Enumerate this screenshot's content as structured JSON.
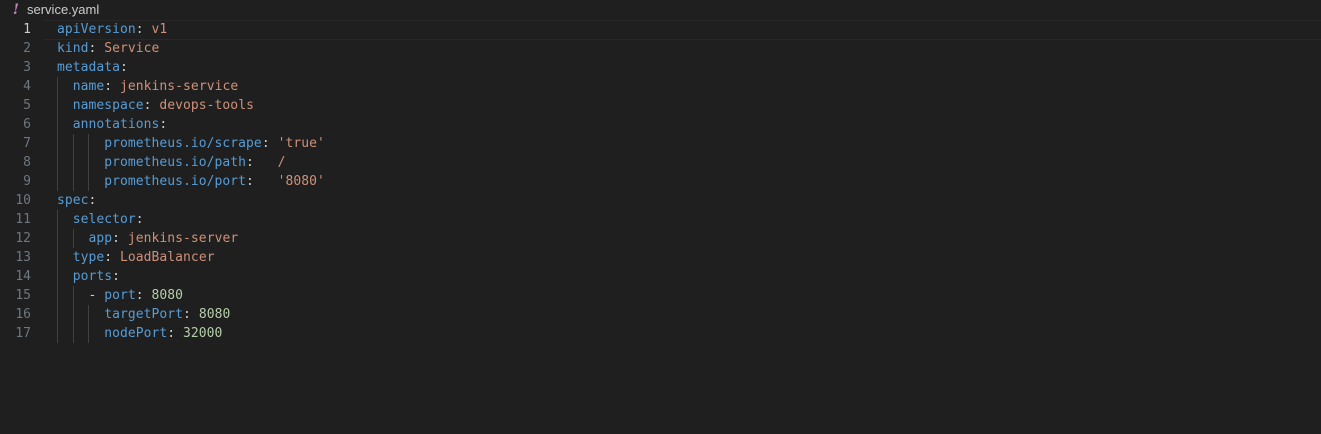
{
  "tab": {
    "icon": "yaml-exclamation-icon",
    "filename": "service.yaml"
  },
  "editor": {
    "current_line": 1,
    "lines": [
      {
        "num": "1",
        "indent": "",
        "key": "apiVersion",
        "sep": ": ",
        "value": "v1",
        "vtype": "s"
      },
      {
        "num": "2",
        "indent": "",
        "key": "kind",
        "sep": ": ",
        "value": "Service",
        "vtype": "s"
      },
      {
        "num": "3",
        "indent": "",
        "key": "metadata",
        "sep": ":",
        "value": "",
        "vtype": "s"
      },
      {
        "num": "4",
        "indent": "  ",
        "key": "name",
        "sep": ": ",
        "value": "jenkins-service",
        "vtype": "s"
      },
      {
        "num": "5",
        "indent": "  ",
        "key": "namespace",
        "sep": ": ",
        "value": "devops-tools",
        "vtype": "s"
      },
      {
        "num": "6",
        "indent": "  ",
        "key": "annotations",
        "sep": ":",
        "value": "",
        "vtype": "s"
      },
      {
        "num": "7",
        "indent": "      ",
        "key": "prometheus.io/scrape",
        "sep": ": ",
        "value": "'true'",
        "vtype": "s"
      },
      {
        "num": "8",
        "indent": "      ",
        "key": "prometheus.io/path",
        "sep": ":   ",
        "value": "/",
        "vtype": "s"
      },
      {
        "num": "9",
        "indent": "      ",
        "key": "prometheus.io/port",
        "sep": ":   ",
        "value": "'8080'",
        "vtype": "s"
      },
      {
        "num": "10",
        "indent": "",
        "key": "spec",
        "sep": ":",
        "value": "",
        "vtype": "s"
      },
      {
        "num": "11",
        "indent": "  ",
        "key": "selector",
        "sep": ":",
        "value": "",
        "vtype": "s"
      },
      {
        "num": "12",
        "indent": "    ",
        "key": "app",
        "sep": ": ",
        "value": "jenkins-server",
        "vtype": "s"
      },
      {
        "num": "13",
        "indent": "  ",
        "key": "type",
        "sep": ": ",
        "value": "LoadBalancer",
        "vtype": "s"
      },
      {
        "num": "14",
        "indent": "  ",
        "key": "ports",
        "sep": ":",
        "value": "",
        "vtype": "s"
      },
      {
        "num": "15",
        "indent": "    - ",
        "key": "port",
        "sep": ": ",
        "value": "8080",
        "vtype": "n"
      },
      {
        "num": "16",
        "indent": "      ",
        "key": "targetPort",
        "sep": ": ",
        "value": "8080",
        "vtype": "n"
      },
      {
        "num": "17",
        "indent": "      ",
        "key": "nodePort",
        "sep": ": ",
        "value": "32000",
        "vtype": "n"
      }
    ]
  },
  "colors": {
    "background": "#1f1f1f",
    "key": "#569cd6",
    "string": "#ce9178",
    "number": "#b5cea8",
    "line_number": "#6e7681",
    "yaml_icon": "#c586c0"
  }
}
